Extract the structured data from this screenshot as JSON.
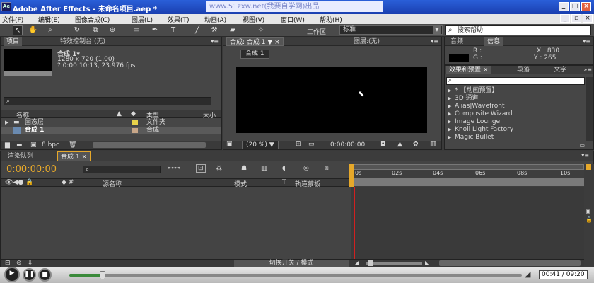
{
  "window": {
    "title": "Adobe After Effects - 未命名项目.aep *",
    "watermark": "www.51zxw.net(我要自学网)出品",
    "icon_label": "Ae"
  },
  "menu": [
    "文件(F)",
    "编辑(E)",
    "图像合成(C)",
    "图层(L)",
    "效果(T)",
    "动画(A)",
    "视图(V)",
    "窗口(W)",
    "帮助(H)"
  ],
  "toolbar": {
    "workspace_label": "工作区:",
    "workspace_value": "标准",
    "search_placeholder": "搜索帮助"
  },
  "project_panel": {
    "tab1": "项目",
    "tab2": "特效控制台:(无)",
    "comp_name": "合成 1▾",
    "comp_size": "1280 x 720 (1.00)",
    "comp_time": "? 0:00:10:13, 23.976 fps",
    "col_name": "名称",
    "col_type": "类型",
    "col_size": "大小",
    "items": [
      {
        "name": "固态层",
        "type": "文件夹",
        "color": "#e8d24a"
      },
      {
        "name": "合成 1",
        "type": "合成",
        "color": "#c8a688"
      }
    ],
    "bpc": "8 bpc"
  },
  "comp_panel": {
    "tab": "合成: 合成 1",
    "layer_tab": "图层:(无)",
    "comp_chip": "合成 1",
    "zoom": "(20 %)",
    "timecode": "0:00:00:00"
  },
  "info_panel": {
    "tab_audio": "音频",
    "tab_info": "信息",
    "r": "R :",
    "g": "G :",
    "x": "X : 830",
    "y": "Y : 265"
  },
  "effects_panel": {
    "tab1": "效果和预置",
    "tab2": "段落",
    "tab3": "文字",
    "items": [
      "* 【动画预置】",
      "3D 通道",
      "Alias|Wavefront",
      "Composite Wizard",
      "Image Lounge",
      "Knoll Light Factory",
      "Magic Bullet"
    ]
  },
  "timeline": {
    "tab_render": "渲染队列",
    "tab_comp": "合成 1",
    "timecode": "0:00:00:00",
    "col_source": "源名称",
    "col_mode": "模式",
    "col_t": "T",
    "col_trkmat": "轨道蒙板",
    "ruler": [
      "0s",
      "02s",
      "04s",
      "06s",
      "08s",
      "10s"
    ],
    "switch_label": "切换开关 / 模式"
  },
  "player": {
    "time": "00:41 / 09:20",
    "progress": 0.073
  },
  "colors": {
    "accent": "#e6a82a",
    "playhead": "#d02020",
    "titlebar": "#2a5fd8"
  }
}
